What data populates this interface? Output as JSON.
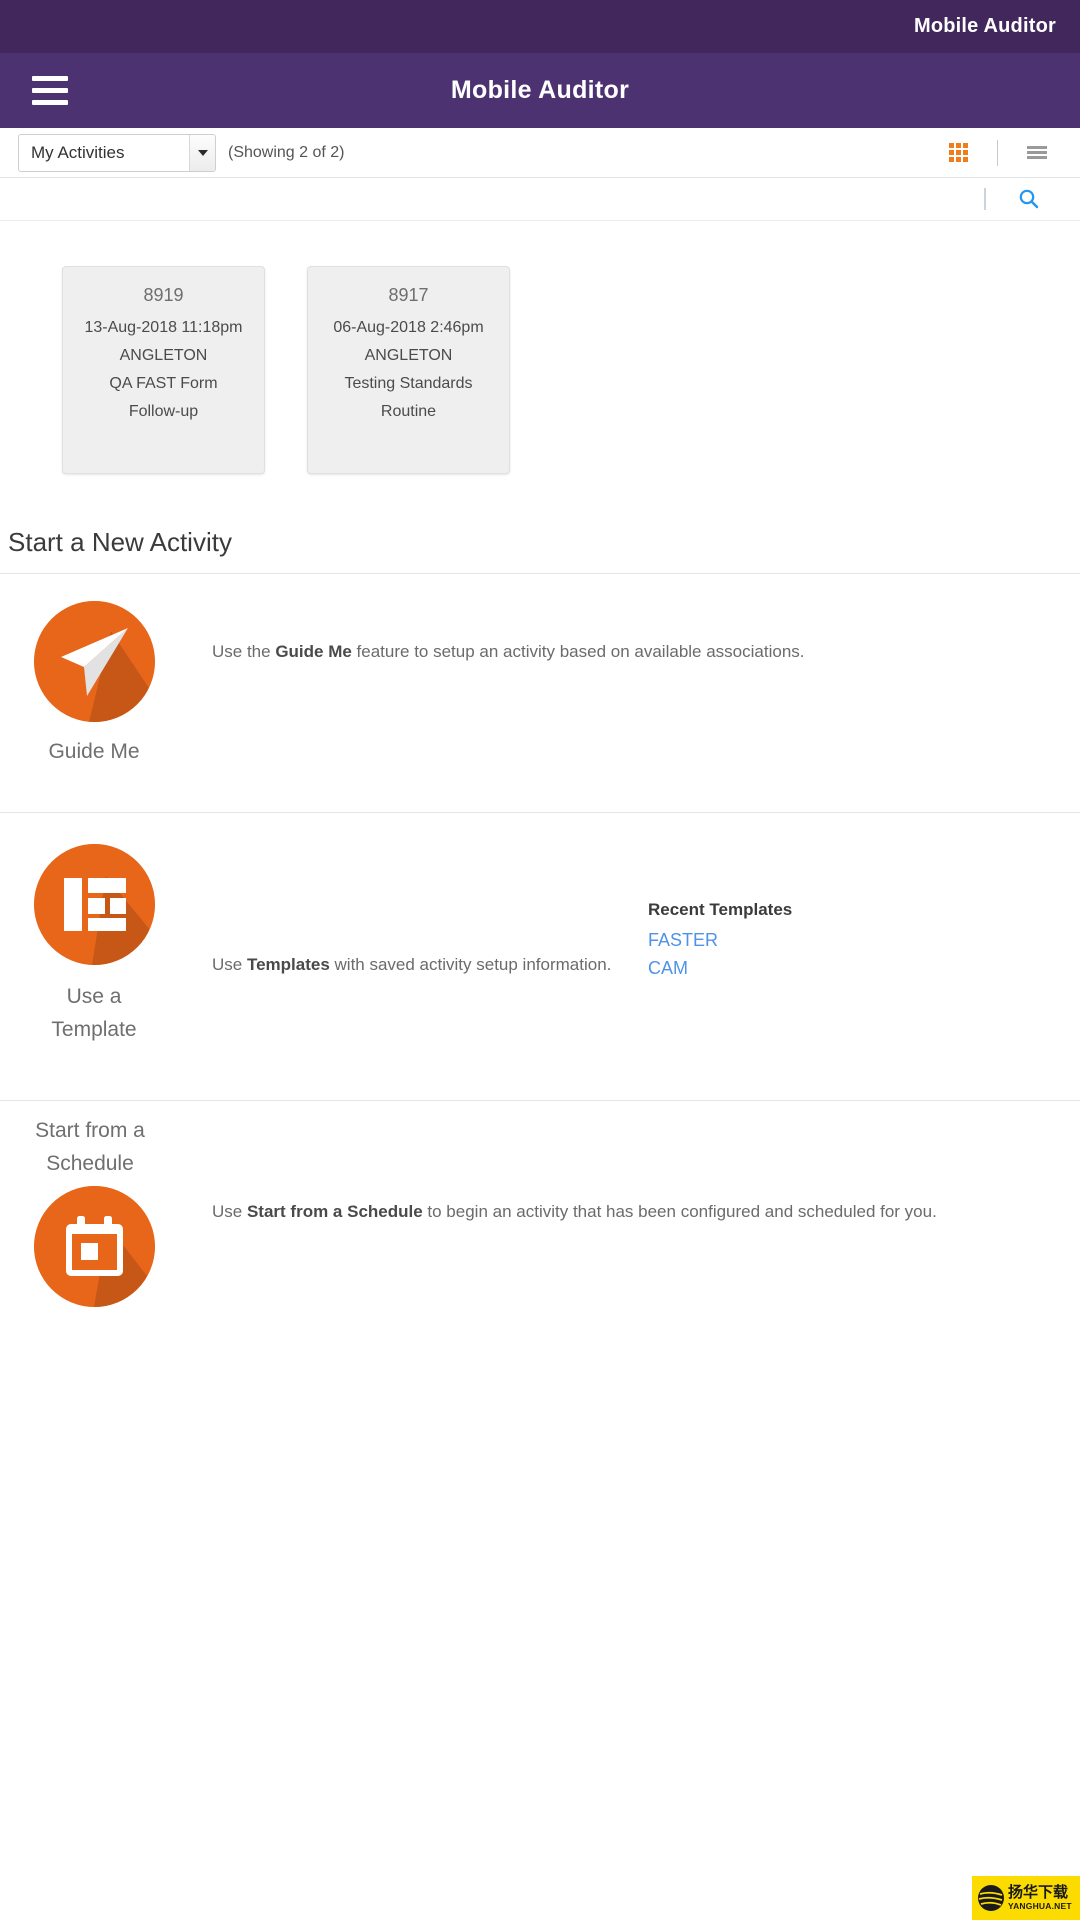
{
  "status_bar": {
    "title": "Mobile Auditor"
  },
  "app_bar": {
    "title": "Mobile Auditor",
    "menu_icon": "hamburger-menu-icon"
  },
  "toolbar": {
    "filter_value": "My Activities",
    "filter_options": [
      "My Activities"
    ],
    "showing_text": "(Showing 2 of 2)",
    "grid_view_icon": "grid-view-icon",
    "list_view_icon": "list-view-icon",
    "grid_view_color": "#f07c1a",
    "list_view_color": "#9a9a9a"
  },
  "search": {
    "icon": "search-icon",
    "icon_color": "#2196f3"
  },
  "activities": [
    {
      "id": "8919",
      "datetime": "13-Aug-2018 11:18pm",
      "location": "ANGLETON",
      "form": "QA FAST Form",
      "type": "Follow-up"
    },
    {
      "id": "8917",
      "datetime": "06-Aug-2018 2:46pm",
      "location": "ANGLETON",
      "form": "Testing Standards",
      "type": "Routine"
    }
  ],
  "new_activity": {
    "heading": "Start a New Activity",
    "options": [
      {
        "label": "Guide Me",
        "icon": "paper-plane-icon",
        "desc_pre": "Use the ",
        "desc_bold": "Guide Me",
        "desc_post": " feature to setup an activity based on available associations."
      },
      {
        "label": "Use a\nTemplate",
        "label_line1": "Use a",
        "label_line2": "Template",
        "icon": "template-layout-icon",
        "desc_pre": "Use ",
        "desc_bold": "Templates",
        "desc_post": " with saved activity setup information."
      },
      {
        "label_line1": "Start from a",
        "label_line2": "Schedule",
        "icon": "calendar-icon",
        "desc_pre": "Use ",
        "desc_bold": "Start from a Schedule",
        "desc_post": " to begin an activity that has been configured and scheduled for you."
      }
    ],
    "recent_templates": {
      "title": "Recent Templates",
      "items": [
        "FASTER",
        "CAM"
      ]
    }
  },
  "watermark": {
    "chinese": "扬华下载",
    "english": "YANGHUA.NET",
    "background": "#fcdc00"
  },
  "theme": {
    "status_bar_purple": "#42275c",
    "app_bar_purple": "#4d3271",
    "accent_orange": "#e8661a",
    "link_blue": "#4f93e8"
  }
}
